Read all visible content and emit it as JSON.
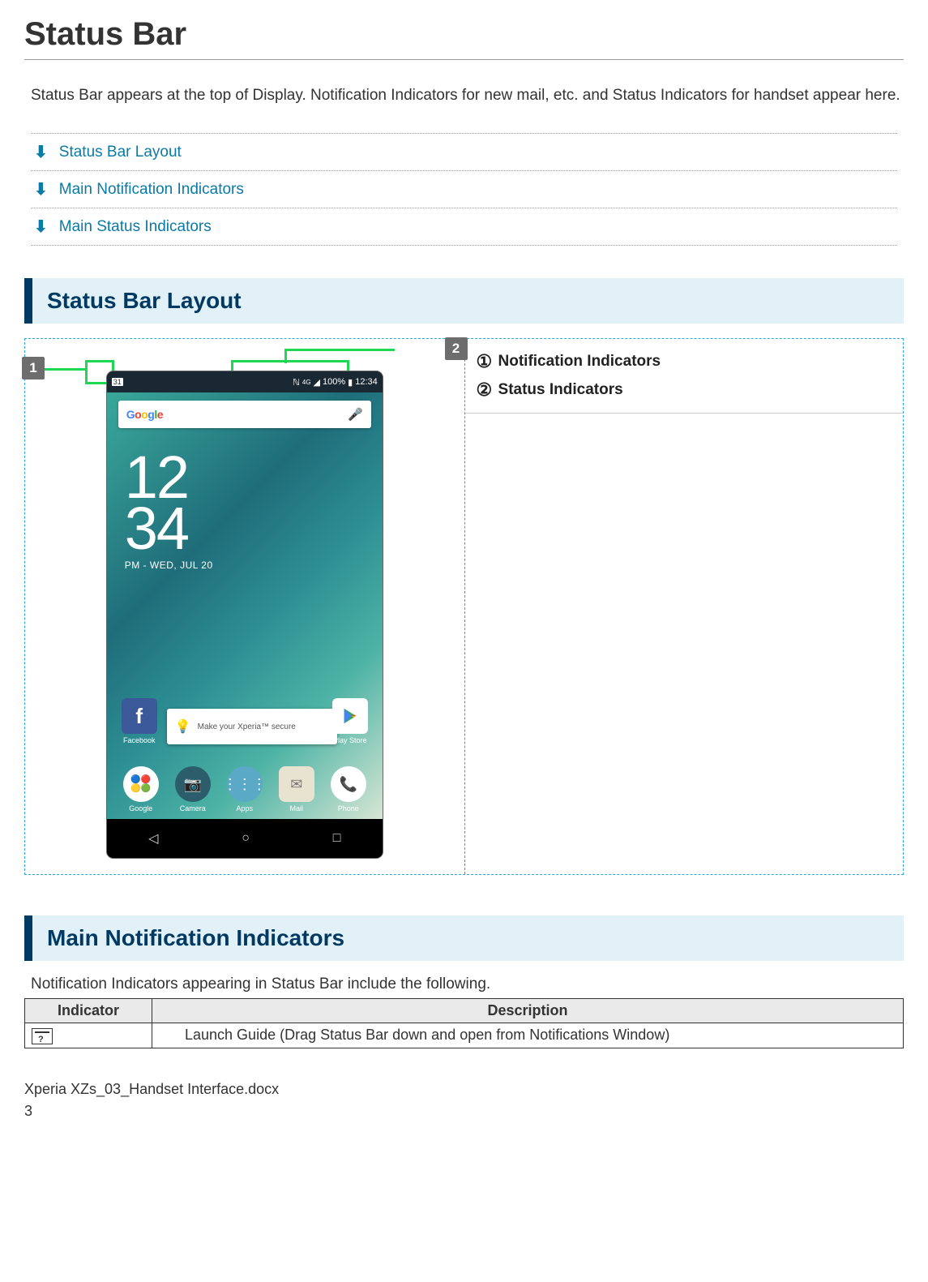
{
  "title": "Status Bar",
  "intro": "Status Bar appears at the top of Display. Notification Indicators for new mail, etc. and Status Indicators for handset appear here.",
  "toc": [
    "Status Bar Layout",
    "Main Notification Indicators",
    "Main Status Indicators"
  ],
  "section1": {
    "heading": "Status Bar Layout",
    "callouts": {
      "c1": "Notification Indicators",
      "c2": "Status Indicators"
    },
    "badge1": "1",
    "badge2": "2"
  },
  "phone": {
    "status_left_icon": "31",
    "status_right": {
      "nfc": "ℕ",
      "net": "4G",
      "signal": "▮",
      "batt": "100%",
      "time": "12:34"
    },
    "search_brand": [
      "G",
      "o",
      "o",
      "g",
      "l",
      "e"
    ],
    "clock_time_top": "12",
    "clock_time_bot": "34",
    "clock_date": "PM - WED, JUL 20",
    "notif_card": "Make your Xperia™ secure",
    "apps": {
      "facebook": "Facebook",
      "playstore": "Play Store",
      "google": "Google",
      "camera": "Camera",
      "apps": "Apps",
      "mail": "Mail",
      "phone": "Phone"
    }
  },
  "section2": {
    "heading": "Main Notification Indicators",
    "intro": "Notification Indicators appearing in Status Bar include the following.",
    "table": {
      "col1": "Indicator",
      "col2": "Description",
      "row1_desc": "Launch Guide (Drag Status Bar down and open from Notifications Window)"
    }
  },
  "footer": {
    "filename": "Xperia XZs_03_Handset Interface.docx",
    "page": "3"
  }
}
